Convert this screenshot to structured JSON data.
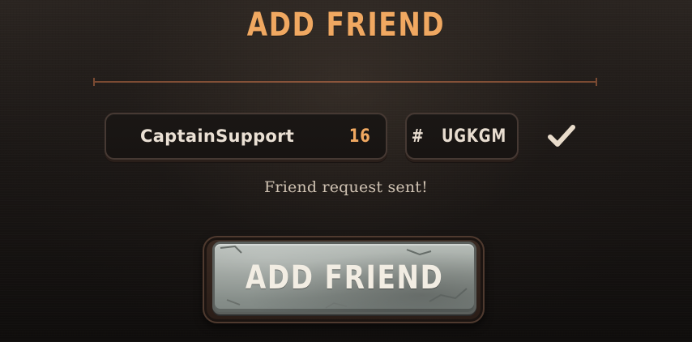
{
  "colors": {
    "accent": "#f0a861"
  },
  "header": {
    "title": "ADD FRIEND"
  },
  "form": {
    "username": "CaptainSupport",
    "level": "16",
    "tag_prefix": "#",
    "tag": "UGKGM",
    "confirm_icon": "check-icon"
  },
  "status": {
    "message": "Friend request sent!"
  },
  "action": {
    "button_label": "ADD FRIEND"
  }
}
